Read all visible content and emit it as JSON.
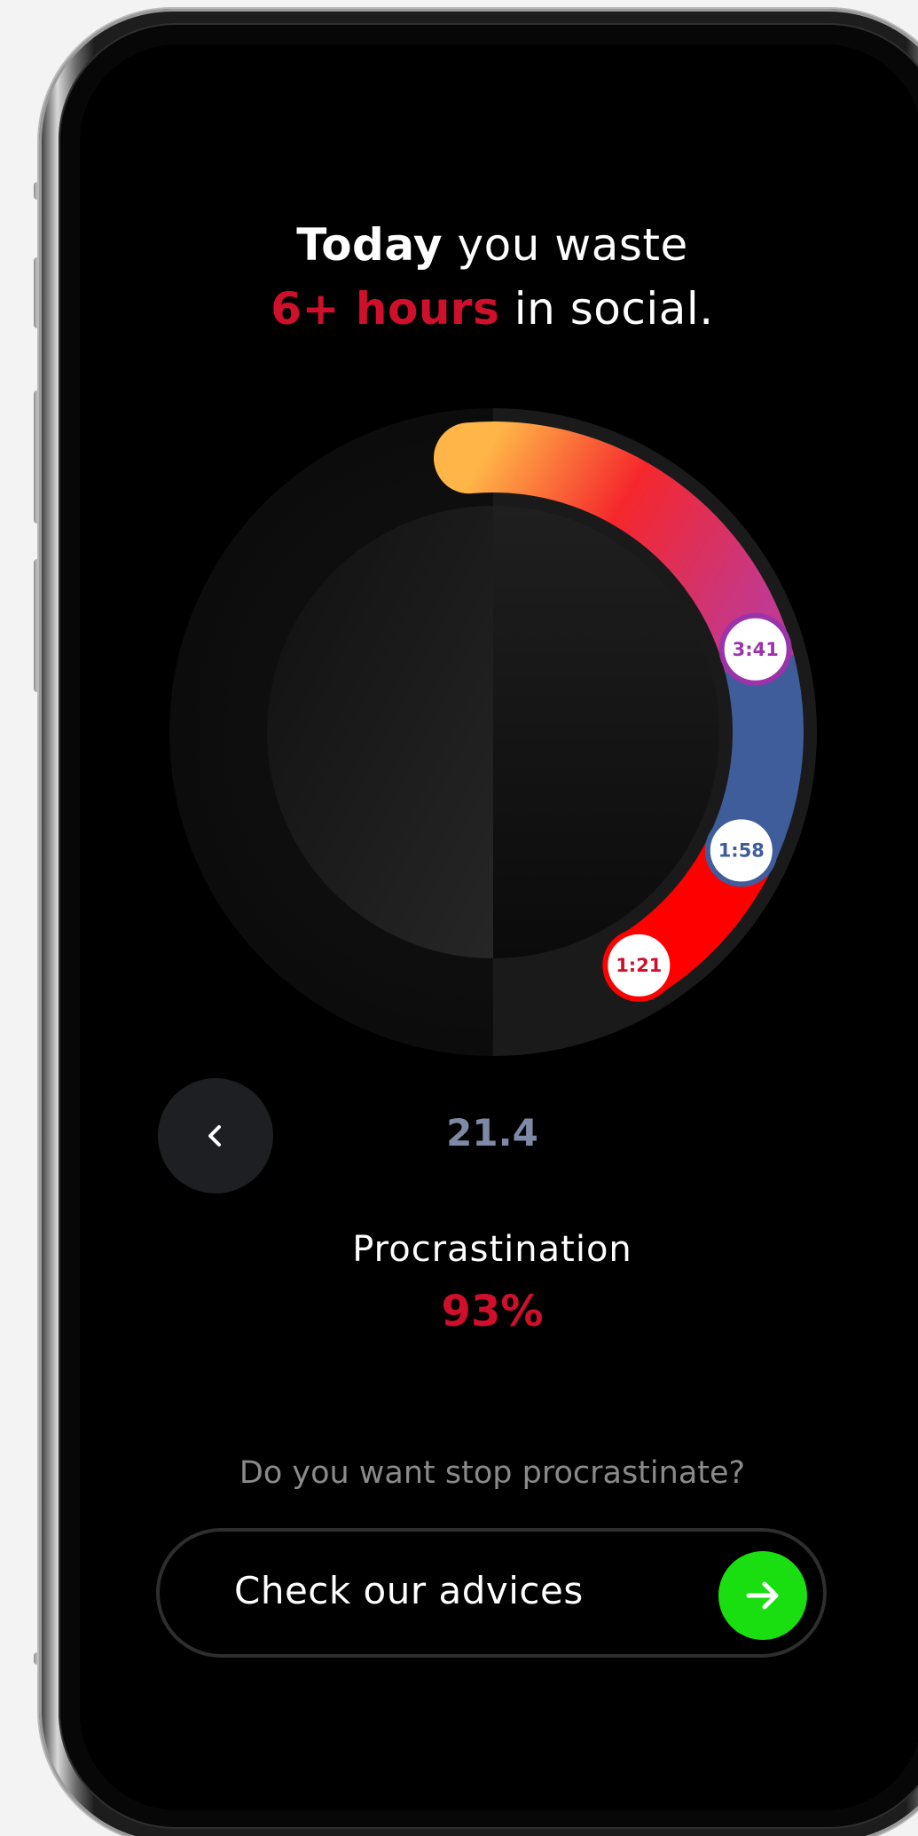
{
  "headline": {
    "line1_bold": "Today",
    "line1_rest": " you waste",
    "line2_accent": "6+ hours",
    "line2_rest": " in social."
  },
  "colors": {
    "accent_red": "#d0102a",
    "ring_gradient": [
      "#ffb547",
      "#f5272c",
      "#c2398f"
    ],
    "ring_blue": "#3f5d9a",
    "ring_red": "#ff0000",
    "cta_green": "#19df10"
  },
  "chart_data": {
    "type": "radial-segments",
    "segments": [
      {
        "label": "3:41",
        "minutes": 221,
        "color": "#c2398f"
      },
      {
        "label": "1:58",
        "minutes": 118,
        "color": "#3f5d9a"
      },
      {
        "label": "1:21",
        "minutes": 81,
        "color": "#ff0000"
      }
    ]
  },
  "date_value": "21.4",
  "metric": {
    "label": "Procrastination",
    "value": "93%"
  },
  "prompt": {
    "question": "Do you want stop procrastinate?",
    "cta_label": "Check our advices"
  },
  "icons": {
    "back": "chevron-left-icon",
    "cta": "arrow-right-icon"
  }
}
